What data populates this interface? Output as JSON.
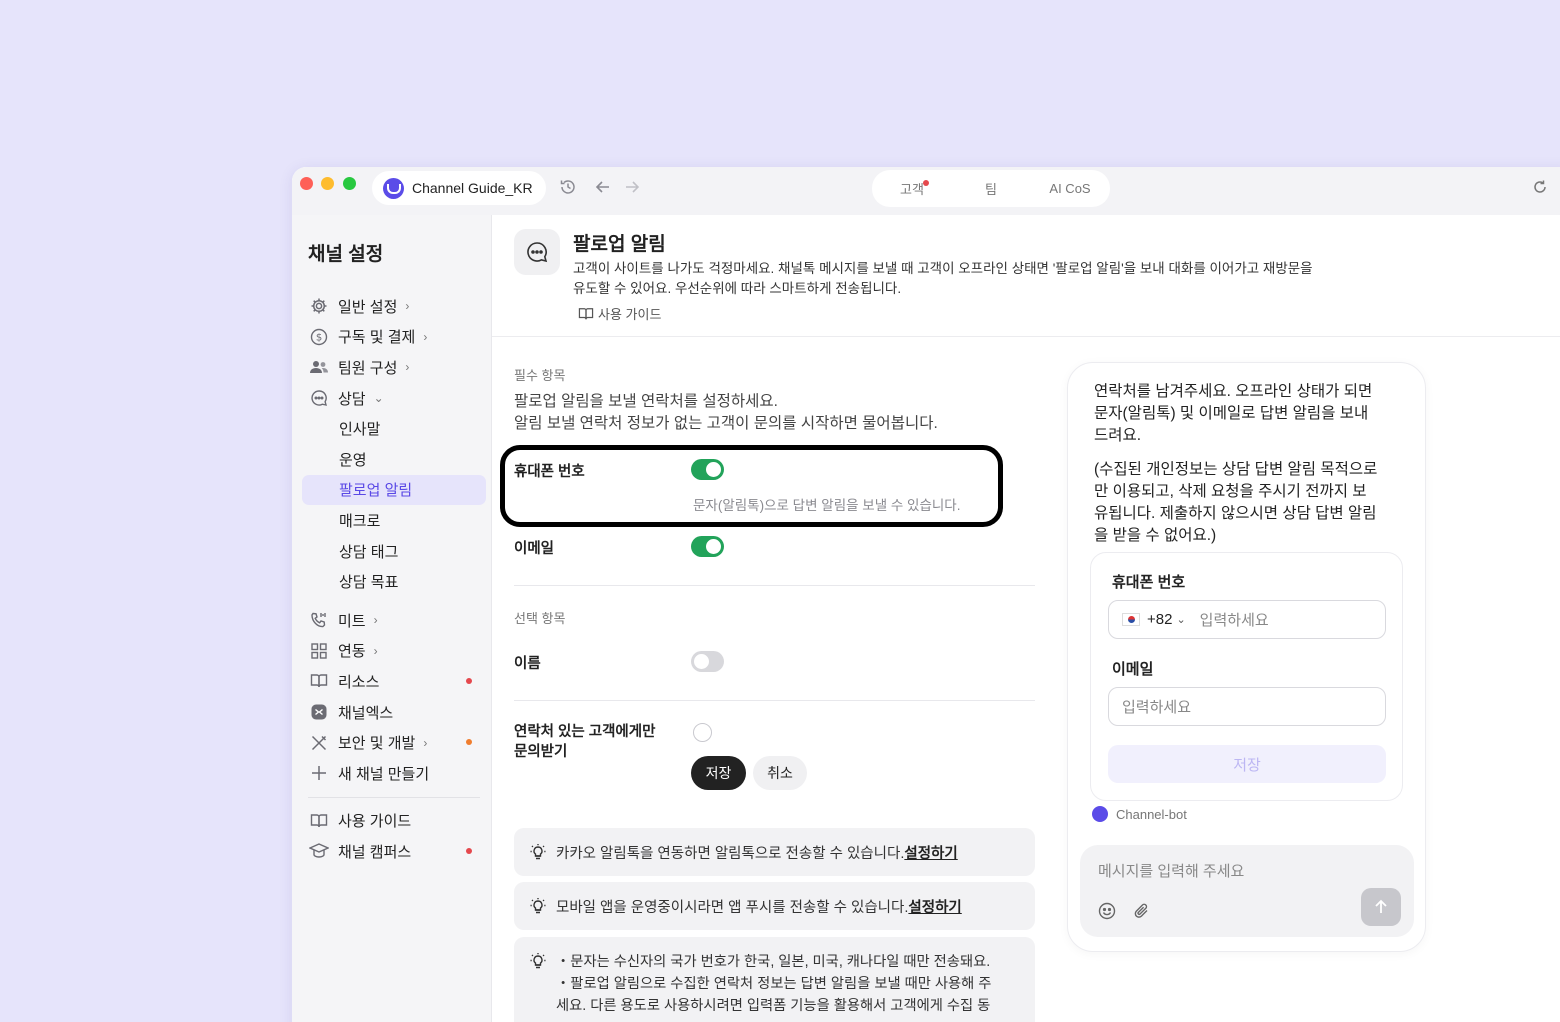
{
  "titlebar": {
    "channel_name": "Channel Guide_KR",
    "segments": [
      "고객",
      "팀",
      "AI CoS"
    ]
  },
  "sidebar": {
    "title": "채널 설정",
    "items": [
      {
        "label": "일반 설정",
        "icon": "gear-icon"
      },
      {
        "label": "구독 및 결제",
        "icon": "dollar-icon"
      },
      {
        "label": "팀원 구성",
        "icon": "users-icon"
      },
      {
        "label": "상담",
        "icon": "chat-icon"
      },
      {
        "label": "인사말"
      },
      {
        "label": "운영"
      },
      {
        "label": "팔로업 알림"
      },
      {
        "label": "매크로"
      },
      {
        "label": "상담 태그"
      },
      {
        "label": "상담 목표"
      },
      {
        "label": "미트",
        "icon": "phone-icon"
      },
      {
        "label": "연동",
        "icon": "grid-icon"
      },
      {
        "label": "리소스",
        "icon": "book-icon"
      },
      {
        "label": "채널엑스",
        "icon": "channelx-icon"
      },
      {
        "label": "보안 및 개발",
        "icon": "tools-icon"
      },
      {
        "label": "새 채널 만들기",
        "icon": "plus-icon"
      },
      {
        "label": "사용 가이드",
        "icon": "book-icon"
      },
      {
        "label": "채널 캠퍼스",
        "icon": "graduation-icon"
      }
    ],
    "dot_colors": {
      "red": "#e5484d",
      "orange": "#f07d2e"
    }
  },
  "header": {
    "title": "팔로업 알림",
    "desc_line1": "고객이 사이트를 나가도 걱정마세요. 채널톡 메시지를 보낼 때 고객이 오프라인 상태면 '팔로업 알림'을 보내 대화를 이어가고 재방문을",
    "desc_line2": "유도할 수 있어요. 우선순위에 따라 스마트하게 전송됩니다.",
    "guide": "사용 가이드"
  },
  "required": {
    "label": "필수 항목",
    "desc_line1": "팔로업 알림을 보낼 연락처를 설정하세요.",
    "desc_line2": "알림 보낼 연락처 정보가 없는 고객이 문의를 시작하면 물어봅니다.",
    "phone_label": "휴대폰 번호",
    "phone_on": true,
    "phone_hint": "문자(알림톡)으로 답변 알림을 보낼 수 있습니다.",
    "email_label": "이메일",
    "email_on": true
  },
  "optional": {
    "label": "선택 항목",
    "name_label": "이름",
    "name_on": false
  },
  "contact_only": {
    "line1": "연락처 있는 고객에게만",
    "line2": "문의받기",
    "checked": false
  },
  "actions": {
    "save": "저장",
    "cancel": "취소"
  },
  "notices": [
    {
      "text": "카카오 알림톡을 연동하면 알림톡으로 전송할 수 있습니다.",
      "link": "설정하기"
    },
    {
      "text": "모바일 앱을 운영중이시라면 앱 푸시를 전송할 수 있습니다.",
      "link": "설정하기"
    },
    {
      "line1": "・문자는 수신자의 국가 번호가 한국, 일본, 미국, 캐나다일 때만 전송돼요.",
      "line2": "・팔로업 알림으로 수집한 연락처 정보는 답변 알림을 보낼 때만 사용해 주",
      "line3": "세요. 다른 용도로 사용하시려면 입력폼 기능을 활용해서 고객에게 수집 동"
    }
  ],
  "preview": {
    "msg_line1": "연락처를 남겨주세요. 오프라인 상태가 되면",
    "msg_line2": "문자(알림톡) 및 이메일로 답변 알림을 보내",
    "msg_line3": "드려요.",
    "privacy_line1": "(수집된 개인정보는 상담 답변 알림 목적으로",
    "privacy_line2": "만 이용되고, 삭제 요청을 주시기 전까지 보",
    "privacy_line3": "유됩니다. 제출하지 않으시면 상담 답변 알림",
    "privacy_line4": "을 받을 수 없어요.)",
    "phone_label": "휴대폰 번호",
    "country_code": "+82",
    "phone_placeholder": "입력하세요",
    "email_label": "이메일",
    "email_placeholder": "입력하세요",
    "save": "저장",
    "bot_name": "Channel-bot",
    "compose_placeholder": "메시지를 입력해 주세요"
  },
  "colors": {
    "accent": "#5a49e6",
    "toggle_on": "#22a35a",
    "background": "#e6e4fb"
  }
}
